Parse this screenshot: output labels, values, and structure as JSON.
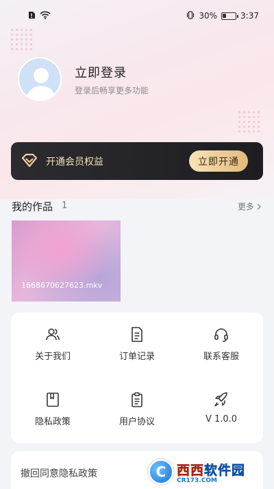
{
  "status_bar": {
    "battery_percent": "30%",
    "time": "3:37",
    "battery_level": 0.3
  },
  "profile": {
    "login_title": "立即登录",
    "login_subtitle": "登录后畅享更多功能"
  },
  "vip": {
    "text": "开通会员权益",
    "button_label": "立即开通"
  },
  "works": {
    "title": "我的作品",
    "count": "1",
    "more_label": "更多",
    "items": [
      {
        "file_name": "1668670627623.mkv"
      }
    ]
  },
  "menu": {
    "items": [
      {
        "label": "关于我们",
        "icon": "people-icon"
      },
      {
        "label": "订单记录",
        "icon": "document-icon"
      },
      {
        "label": "联系客服",
        "icon": "headset-icon"
      },
      {
        "label": "隐私政策",
        "icon": "book-icon"
      },
      {
        "label": "用户协议",
        "icon": "clipboard-icon"
      },
      {
        "label": "V 1.0.0",
        "icon": "rocket-icon"
      }
    ]
  },
  "bottom": {
    "revoke_label": "撤回同意隐私政策"
  },
  "watermark": {
    "main_red": "西西",
    "main_blue": "软件园",
    "sub": "CR173.COM"
  },
  "colors": {
    "vip_bg": "#1e1e22",
    "vip_gold": "#e3b97b",
    "page_bg": "#f3f4f8"
  }
}
